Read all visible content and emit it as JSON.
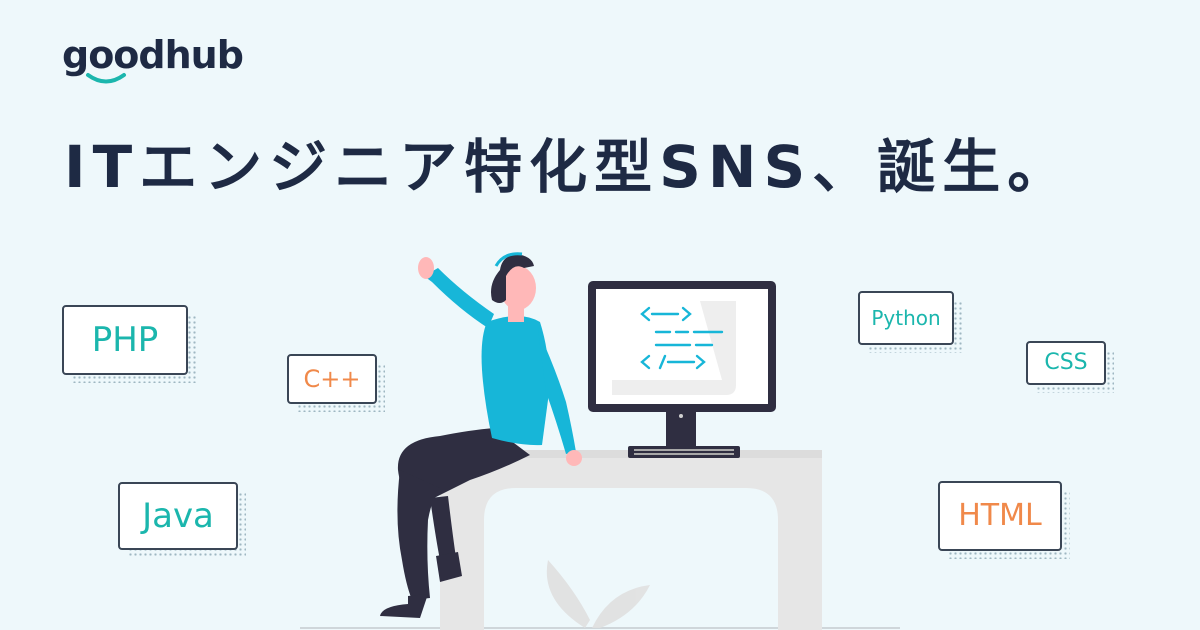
{
  "brand": {
    "name_prefix": "g",
    "name_oo": "oo",
    "name_suffix": "dhub"
  },
  "headline": "ITエンジニア特化型SNS、誕生。",
  "tags": [
    {
      "id": "php",
      "label": "PHP",
      "color": "#1bb6ad"
    },
    {
      "id": "cpp",
      "label": "C++",
      "color": "#f0894a"
    },
    {
      "id": "java",
      "label": "Java",
      "color": "#1bb6ad"
    },
    {
      "id": "python",
      "label": "Python",
      "color": "#1bb6ad"
    },
    {
      "id": "css",
      "label": "CSS",
      "color": "#1bb6ad"
    },
    {
      "id": "html",
      "label": "HTML",
      "color": "#f0894a"
    }
  ],
  "colors": {
    "background": "#eef8fb",
    "navy": "#1e2a44",
    "teal": "#1bb6ad",
    "orange": "#f0894a",
    "shirt": "#17b6d8"
  },
  "illustration": {
    "monitor_icon": "code-brackets-icon",
    "person": "woman-sitting-on-desk"
  }
}
